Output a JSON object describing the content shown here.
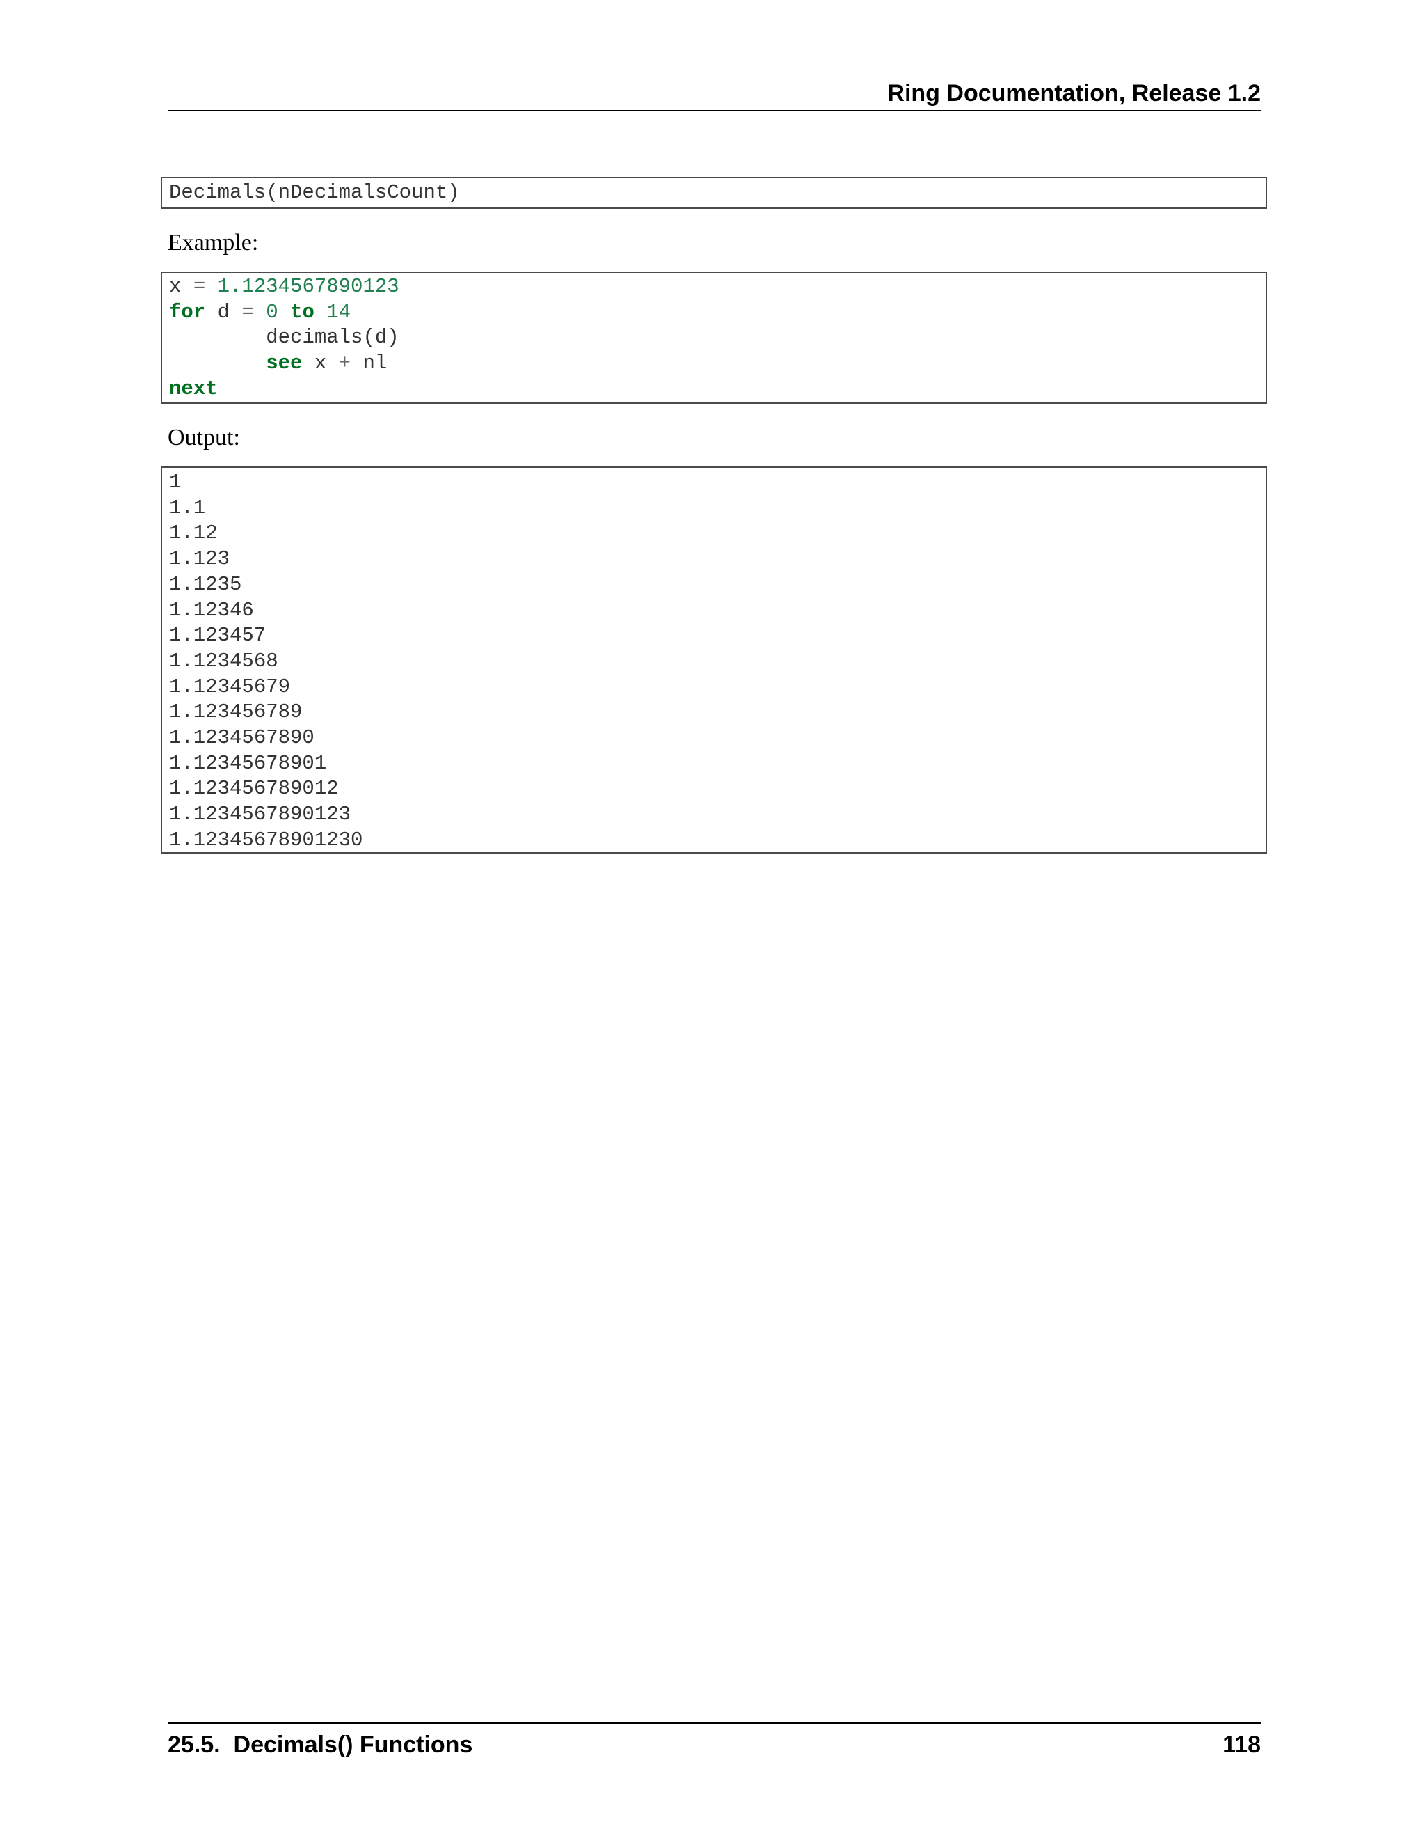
{
  "header": {
    "title": "Ring Documentation, Release 1.2"
  },
  "signature": {
    "code": "Decimals(nDecimalsCount)"
  },
  "labels": {
    "example": "Example:",
    "output": "Output:"
  },
  "example_code": {
    "line1": {
      "var": "x",
      "op": "=",
      "num": "1.1234567890123"
    },
    "line2": {
      "kw_for": "for",
      "var": "d",
      "op": "=",
      "start": "0",
      "kw_to": "to",
      "end": "14"
    },
    "line3": {
      "indent": "        ",
      "text": "decimals(d)"
    },
    "line4": {
      "indent": "        ",
      "kw_see": "see",
      "rest_x": "x",
      "op": "+",
      "rest_nl": "nl"
    },
    "line5": {
      "kw_next": "next"
    }
  },
  "output_lines": [
    "1",
    "1.1",
    "1.12",
    "1.123",
    "1.1235",
    "1.12346",
    "1.123457",
    "1.1234568",
    "1.12345679",
    "1.123456789",
    "1.1234567890",
    "1.12345678901",
    "1.123456789012",
    "1.1234567890123",
    "1.12345678901230"
  ],
  "footer": {
    "section": "25.5.  Decimals() Functions",
    "page": "118"
  },
  "colors": {
    "keyword": "#007020",
    "number": "#208050",
    "output": "#408080",
    "text": "#333333"
  }
}
